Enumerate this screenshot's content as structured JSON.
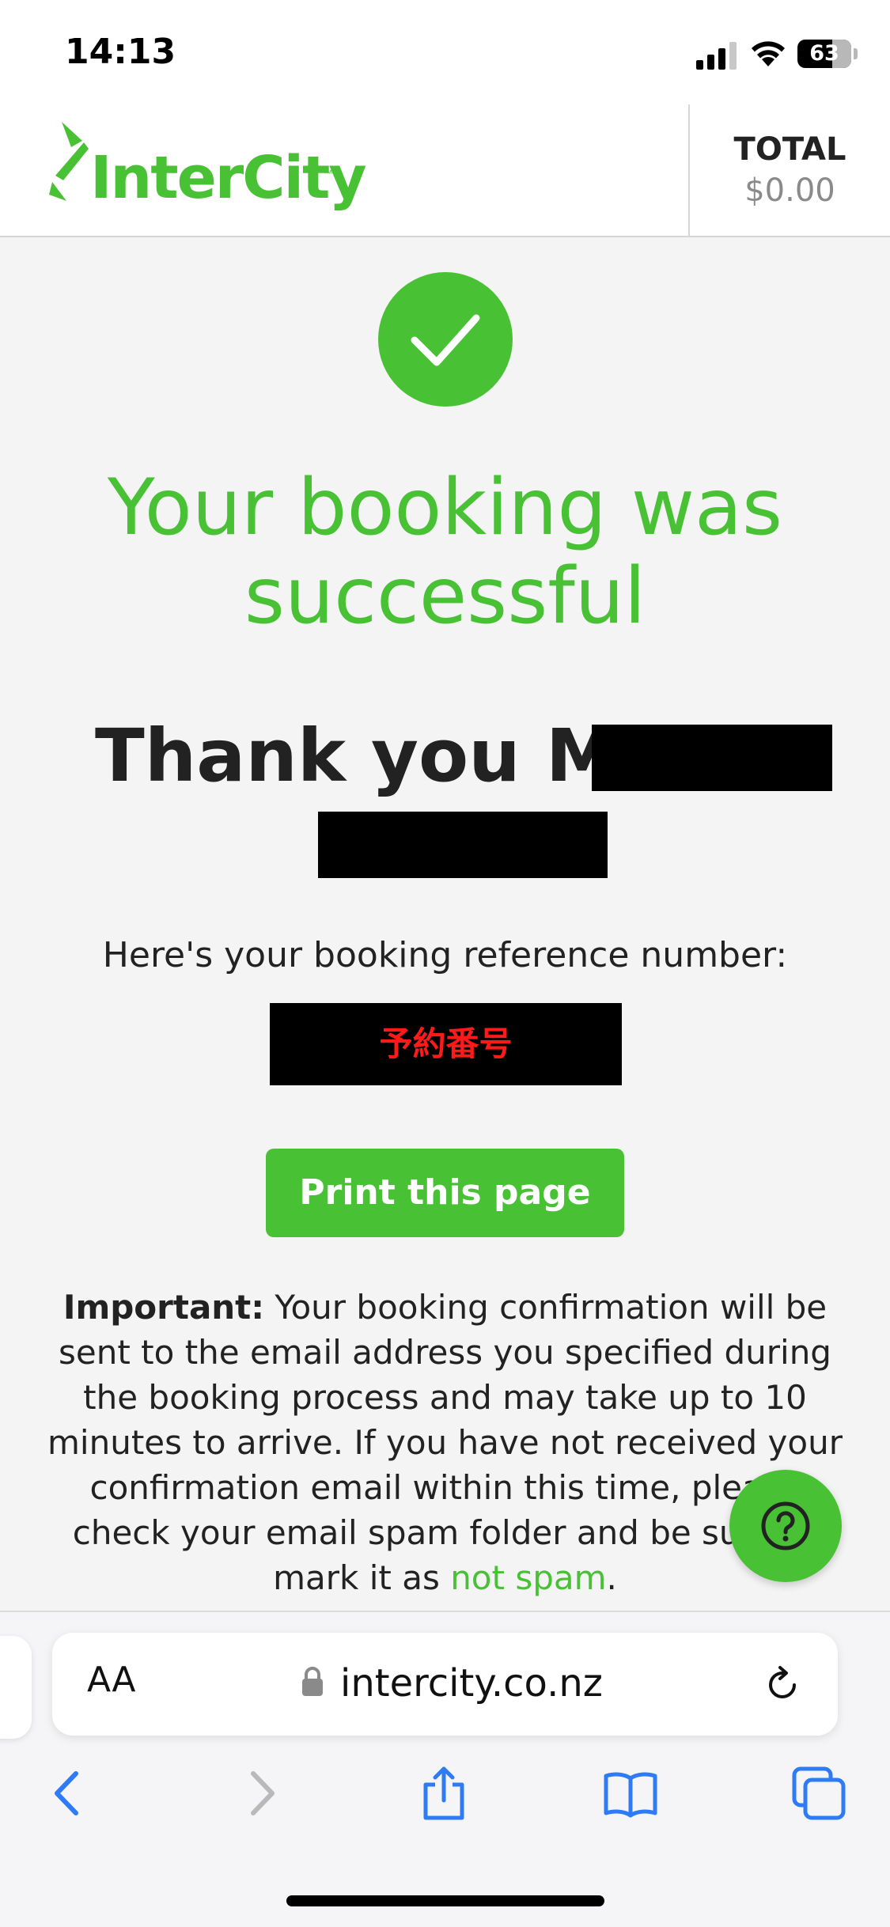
{
  "status_bar": {
    "time": "14:13",
    "battery": "63"
  },
  "header": {
    "logo_text": "InterCity",
    "logo_tm": "™",
    "total_label": "TOTAL",
    "total_value": "$0.00"
  },
  "main": {
    "title": "Your booking was successful",
    "thank_you": "Thank you Mr",
    "reference_label": "Here's your booking reference number:",
    "reference_value": "予約番号",
    "print_button": "Print this page",
    "notice": {
      "lead": "Important:",
      "body": " Your booking confirmation will be sent to the email address you specified during the booking process and may take up to 10 minutes to arrive. If you have not received your confirmation email within this time, please check your email spam folder and be sure to mark it as ",
      "link": "not spam",
      "tail": "."
    }
  },
  "browser": {
    "text_size_label": "AA",
    "url": "intercity.co.nz"
  },
  "colors": {
    "brand_green": "#49c135",
    "ios_blue": "#2f7bf5",
    "reference_red": "#ff1a1a"
  }
}
